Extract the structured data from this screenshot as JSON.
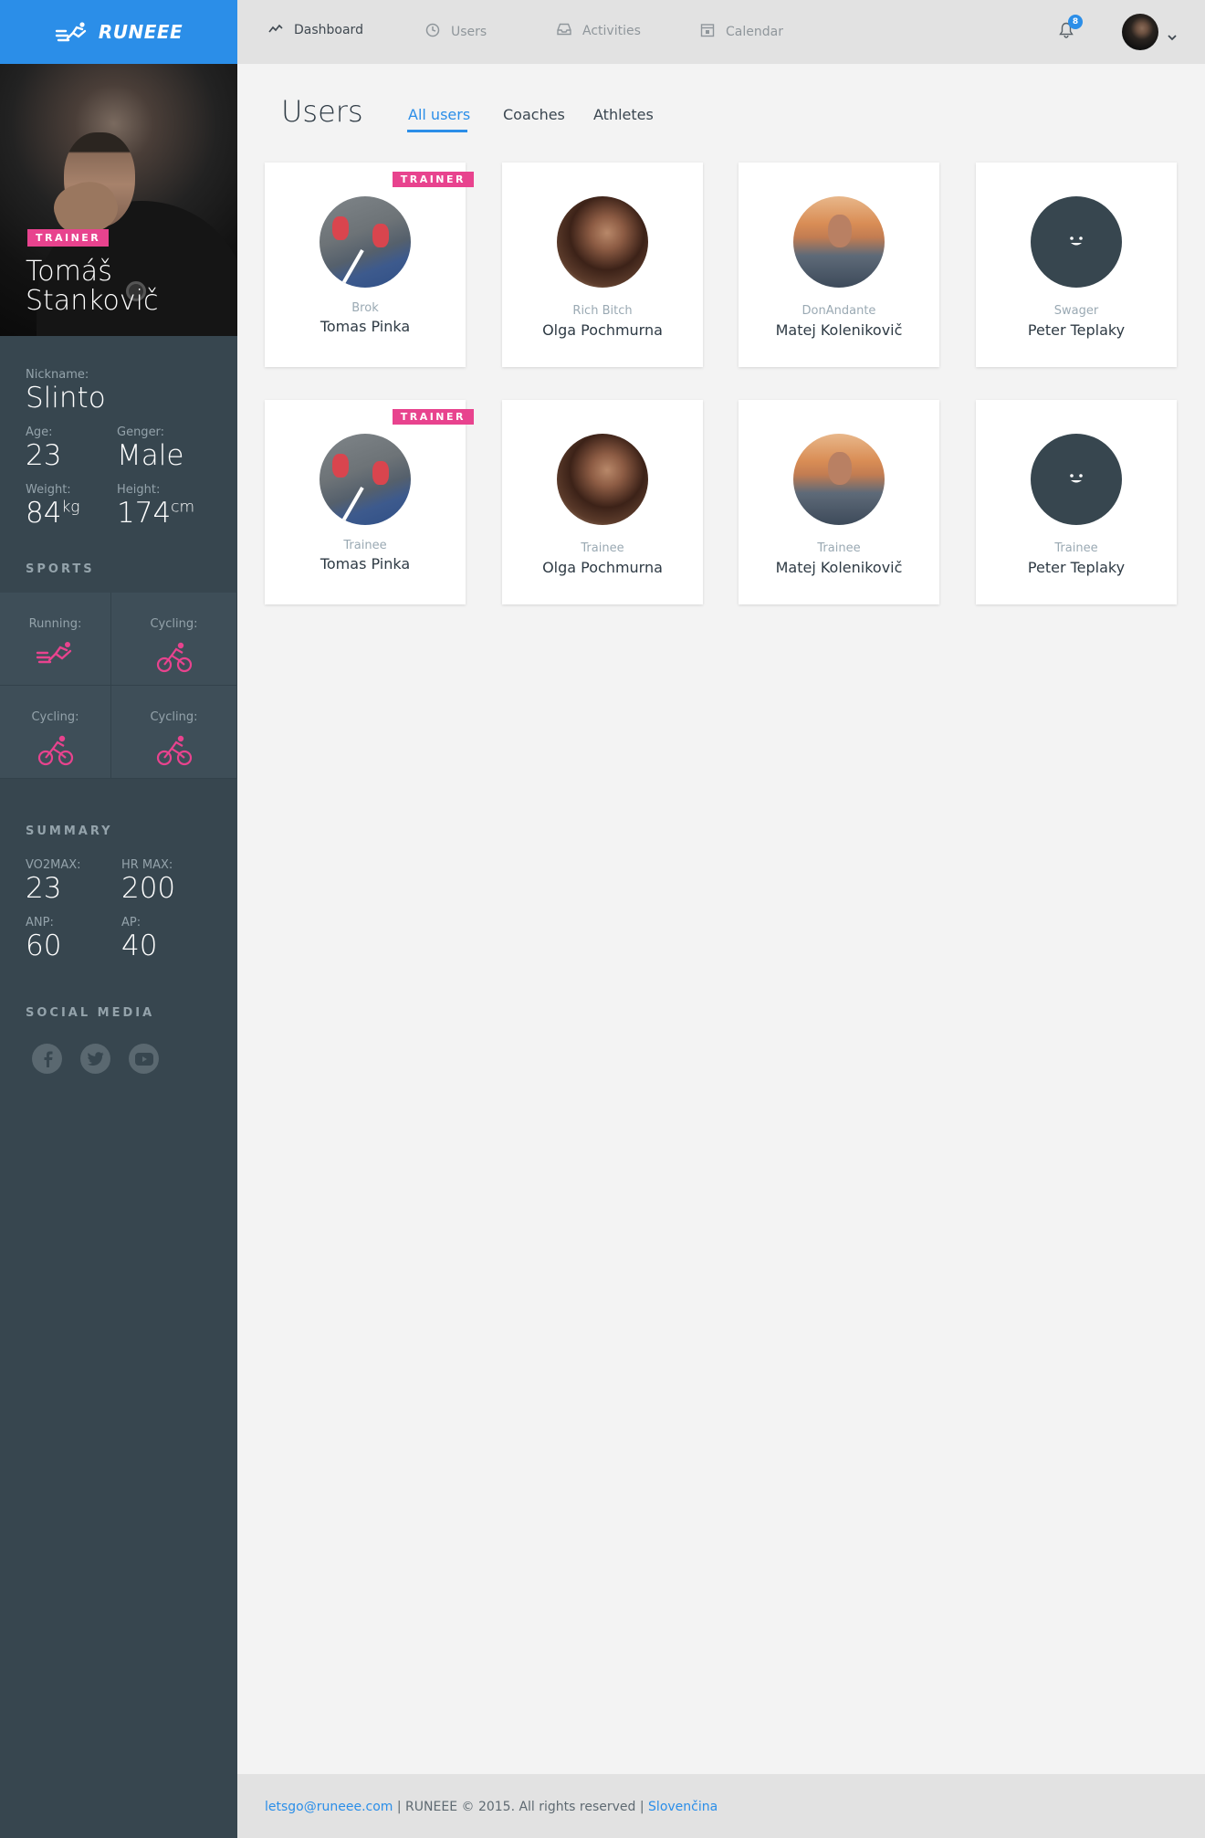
{
  "brand": {
    "name": "RUNEEE",
    "accent": "#2b8ee8",
    "badge_color": "#e8438e"
  },
  "nav": {
    "items": [
      {
        "label": "Dashboard",
        "icon": "activity-icon"
      },
      {
        "label": "Users",
        "icon": "clock-icon"
      },
      {
        "label": "Activities",
        "icon": "inbox-icon"
      },
      {
        "label": "Calendar",
        "icon": "calendar-icon"
      }
    ],
    "notifications_count": "8"
  },
  "profile": {
    "badge": "TRAINER",
    "first_name": "Tomáš",
    "last_name": "Stankovič",
    "nickname_label": "Nickname:",
    "nickname": "Slinto",
    "age_label": "Age:",
    "age": "23",
    "gender_label": "Genger:",
    "gender": "Male",
    "weight_label": "Weight:",
    "weight": "84",
    "weight_unit": "kg",
    "height_label": "Height:",
    "height": "174",
    "height_unit": "cm"
  },
  "sports": {
    "title": "SPORTS",
    "items": [
      {
        "label": "Running:",
        "icon": "running-icon"
      },
      {
        "label": "Cycling:",
        "icon": "cycling-icon"
      },
      {
        "label": "Cycling:",
        "icon": "cycling-icon"
      },
      {
        "label": "Cycling:",
        "icon": "cycling-icon"
      }
    ]
  },
  "summary": {
    "title": "SUMMARY",
    "vo2max_label": "VO2MAX:",
    "vo2max": "23",
    "hrmax_label": "HR MAX:",
    "hrmax": "200",
    "anp_label": "ANP:",
    "anp": "60",
    "ap_label": "AP:",
    "ap": "40"
  },
  "social": {
    "title": "SOCIAL MEDIA",
    "icons": [
      "facebook-icon",
      "twitter-icon",
      "youtube-icon"
    ]
  },
  "main": {
    "title": "Users",
    "tabs": [
      "All users",
      "Coaches",
      "Athletes"
    ],
    "active_tab": "All users",
    "cards": [
      {
        "nick": "Brok",
        "name": "Tomas Pinka",
        "badge": "TRAINER"
      },
      {
        "nick": "Rich Bitch",
        "name": "Olga Pochmurna",
        "badge": ""
      },
      {
        "nick": "DonAndante",
        "name": "Matej Kolenikovič",
        "badge": ""
      },
      {
        "nick": "Swager",
        "name": "Peter Teplaky",
        "badge": ""
      },
      {
        "nick": "Trainee",
        "name": "Tomas Pinka",
        "badge": "TRAINER"
      },
      {
        "nick": "Trainee",
        "name": "Olga Pochmurna",
        "badge": ""
      },
      {
        "nick": "Trainee",
        "name": "Matej Kolenikovič",
        "badge": ""
      },
      {
        "nick": "Trainee",
        "name": "Peter Teplaky",
        "badge": ""
      }
    ]
  },
  "footer": {
    "email": "letsgo@runeee.com",
    "copyright": " | RUNEEE © 2015. All rights reserved | ",
    "language": "Slovenčina"
  }
}
